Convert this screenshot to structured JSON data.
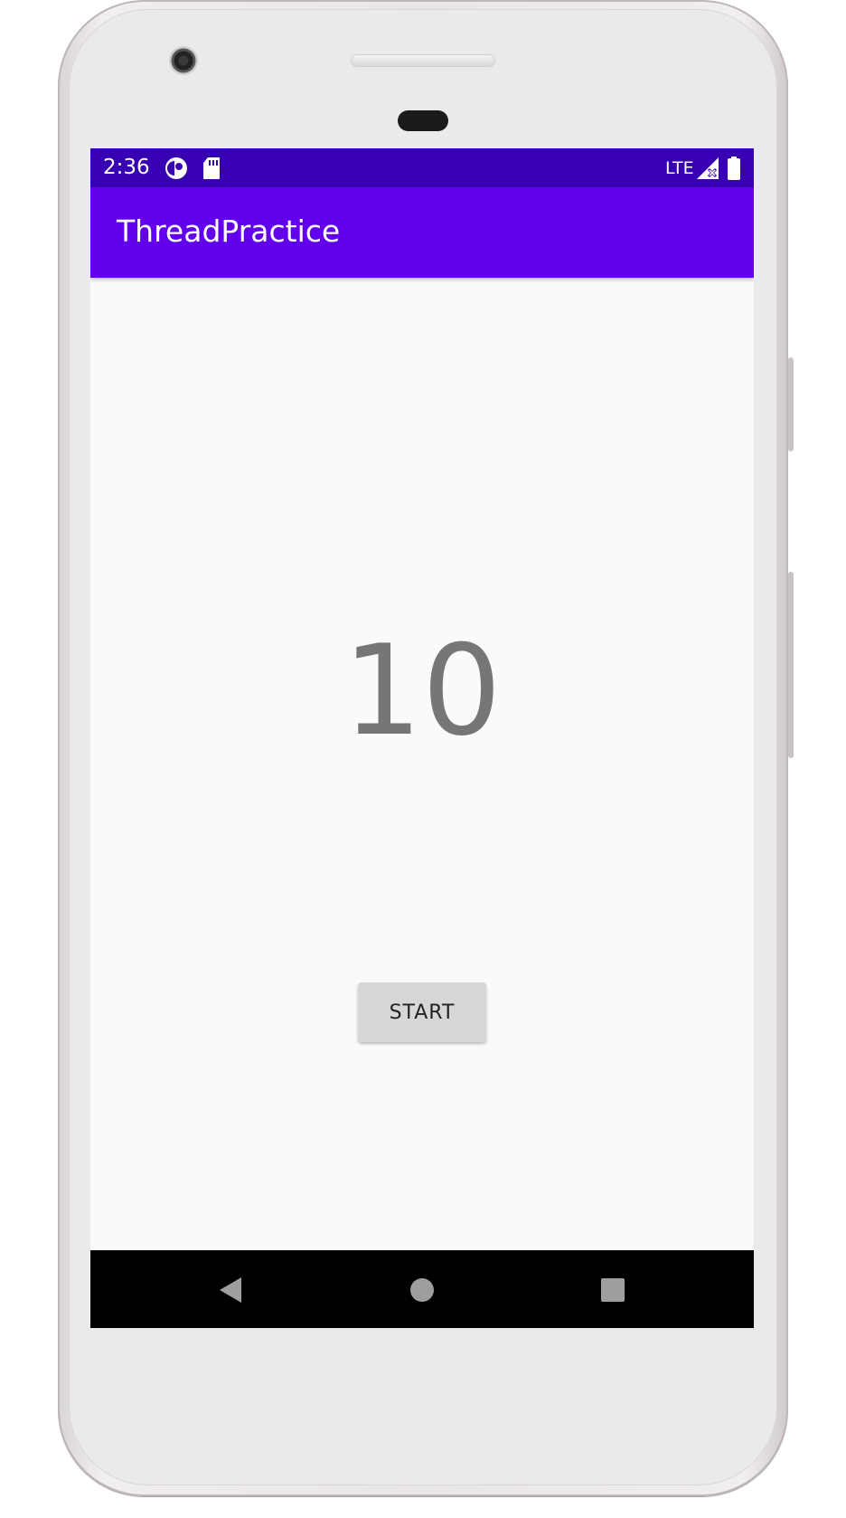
{
  "status_bar": {
    "time": "2:36",
    "network": "LTE",
    "icons": [
      "sync-icon",
      "sd-card-icon",
      "signal-off-icon",
      "battery-icon"
    ]
  },
  "app_bar": {
    "title": "ThreadPractice"
  },
  "main": {
    "counter_value": "10",
    "start_button_label": "START"
  },
  "nav_bar": {
    "icons": [
      "back-icon",
      "home-icon",
      "recents-icon"
    ]
  },
  "colors": {
    "status_bar": "#3700b3",
    "app_bar": "#6200ee",
    "screen_background": "#fafafa",
    "counter_text": "#767676",
    "button_background": "#d6d7d7",
    "nav_bar": "#000000"
  }
}
